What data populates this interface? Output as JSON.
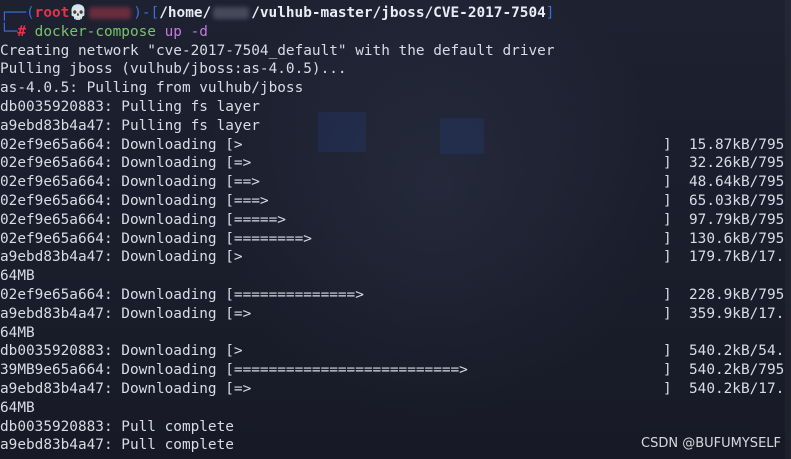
{
  "prompt": {
    "open": "┌──(",
    "user": "root💀",
    "host_sep": ")-[",
    "path_start": "/home/",
    "path_end": "/vulhub-master/jboss/CVE-2017-7504",
    "close": "]",
    "corner": "└─",
    "hash": "#",
    "command": "docker-compose",
    "args": "up -d"
  },
  "output_lines": [
    "Creating network \"cve-2017-7504_default\" with the default driver",
    "Pulling jboss (vulhub/jboss:as-4.0.5)...",
    "as-4.0.5: Pulling from vulhub/jboss",
    "db0035920883: Pulling fs layer",
    "a9ebd83b4a47: Pulling fs layer"
  ],
  "download_lines": [
    {
      "type": "progress",
      "left": "02ef9e65a664: Downloading [>",
      "right": "]  15.87kB/795"
    },
    {
      "type": "progress",
      "left": "02ef9e65a664: Downloading [=>",
      "right": "]  32.26kB/795"
    },
    {
      "type": "progress",
      "left": "02ef9e65a664: Downloading [==>",
      "right": "]  48.64kB/795"
    },
    {
      "type": "progress",
      "left": "02ef9e65a664: Downloading [===>",
      "right": "]  65.03kB/795"
    },
    {
      "type": "progress",
      "left": "02ef9e65a664: Downloading [=====>",
      "right": "]  97.79kB/795"
    },
    {
      "type": "progress",
      "left": "02ef9e65a664: Downloading [========>",
      "right": "]  130.6kB/795"
    },
    {
      "type": "progress",
      "left": "a9ebd83b4a47: Downloading [>",
      "right": "]  179.7kB/17."
    },
    {
      "type": "text",
      "left": "64MB"
    },
    {
      "type": "progress",
      "left": "02ef9e65a664: Downloading [==============>",
      "right": "]  228.9kB/795"
    },
    {
      "type": "progress",
      "left": "a9ebd83b4a47: Downloading [=>",
      "right": "]  359.9kB/17."
    },
    {
      "type": "text",
      "left": "64MB"
    },
    {
      "type": "progress",
      "left": "db0035920883: Downloading [>",
      "right": "]  540.2kB/54."
    },
    {
      "type": "progress",
      "left": "39MB9e65a664: Downloading [==========================>",
      "right": "]  540.2kB/795"
    },
    {
      "type": "progress",
      "left": "a9ebd83b4a47: Downloading [=>",
      "right": "]  540.2kB/17."
    },
    {
      "type": "text",
      "left": "64MB"
    },
    {
      "type": "text",
      "left": "db0035920883: Pull complete"
    },
    {
      "type": "text",
      "left": "a9ebd83b4a47: Pull complete"
    }
  ],
  "watermark": "CSDN @BUFUMYSELF",
  "colors": {
    "background": "#1b1e2b",
    "prompt_bracket": "#3b6fd6",
    "prompt_user": "#e8324a",
    "command": "#79c36b",
    "arg": "#c678dd",
    "text": "#d9dbe6"
  }
}
